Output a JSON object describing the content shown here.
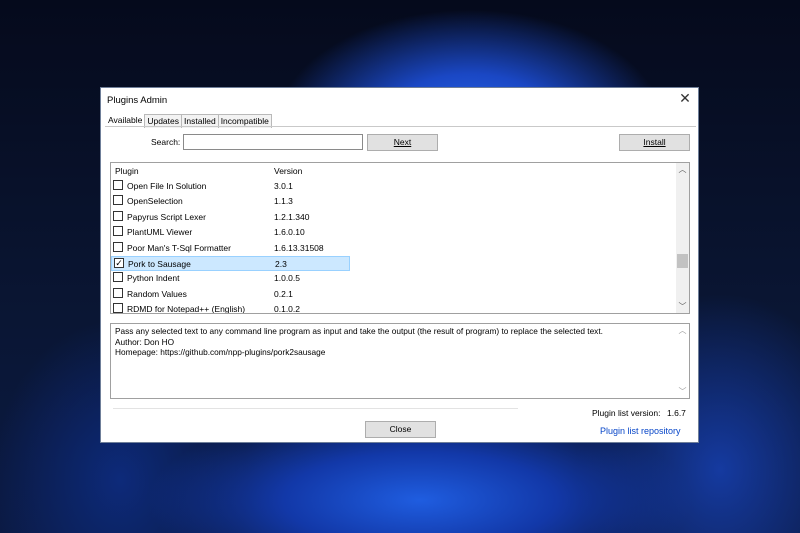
{
  "dialog": {
    "title": "Plugins Admin"
  },
  "tabs": [
    {
      "label": "Available",
      "active": true
    },
    {
      "label": "Updates",
      "active": false
    },
    {
      "label": "Installed",
      "active": false
    },
    {
      "label": "Incompatible",
      "active": false
    }
  ],
  "search": {
    "label": "Search:",
    "value": ""
  },
  "buttons": {
    "next": "Next",
    "install": "Install",
    "close": "Close"
  },
  "list": {
    "headers": {
      "plugin": "Plugin",
      "version": "Version"
    },
    "rows": [
      {
        "name": "Open File In Solution",
        "version": "3.0.1",
        "checked": false
      },
      {
        "name": "OpenSelection",
        "version": "1.1.3",
        "checked": false
      },
      {
        "name": "Papyrus Script Lexer",
        "version": "1.2.1.340",
        "checked": false
      },
      {
        "name": "PlantUML Viewer",
        "version": "1.6.0.10",
        "checked": false
      },
      {
        "name": "Poor Man's T-Sql Formatter",
        "version": "1.6.13.31508",
        "checked": false
      },
      {
        "name": "Pork to Sausage",
        "version": "2.3",
        "checked": true,
        "selected": true
      },
      {
        "name": "Python Indent",
        "version": "1.0.0.5",
        "checked": false
      },
      {
        "name": "Random Values",
        "version": "0.2.1",
        "checked": false
      },
      {
        "name": "RDMD for Notepad++ (English)",
        "version": "0.1.0.2",
        "checked": false
      }
    ]
  },
  "description": {
    "line1": "Pass any selected text to any command line program as input and take the output (the result of program) to replace the selected text.",
    "line2": "Author: Don HO",
    "line3": "Homepage: https://github.com/npp-plugins/pork2sausage"
  },
  "footer": {
    "plugin_list_version_label": "Plugin list version:",
    "plugin_list_version": "1.6.7",
    "repository_link": "Plugin list repository"
  },
  "icons": {
    "close": "close-icon",
    "checkbox": "checkbox-icon",
    "scroll_up": "chevron-up-icon",
    "scroll_down": "chevron-down-icon"
  }
}
